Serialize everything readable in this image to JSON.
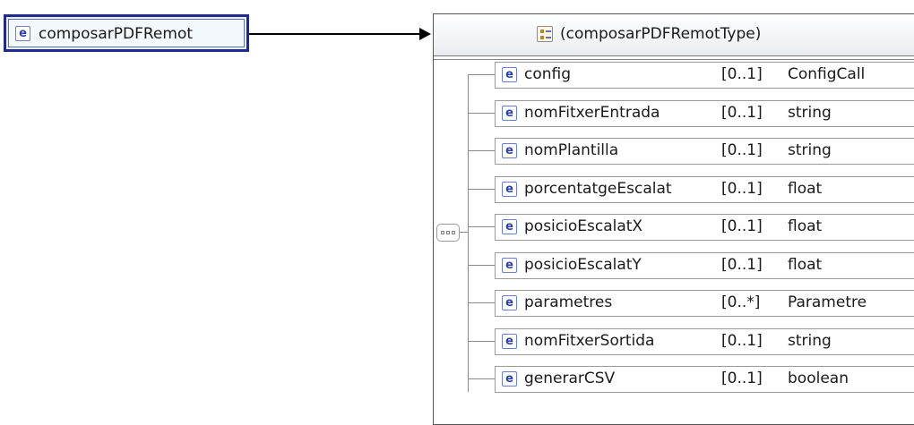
{
  "root_element": {
    "icon": "e",
    "name": "composarPDFRemot"
  },
  "complex_type": {
    "icon": "complex-type-icon",
    "name": "(composarPDFRemotType)"
  },
  "compositor": {
    "icon": "sequence-icon"
  },
  "children": [
    {
      "icon": "e",
      "name": "config",
      "occurs": "[0..1]",
      "type": "ConfigCall"
    },
    {
      "icon": "e",
      "name": "nomFitxerEntrada",
      "occurs": "[0..1]",
      "type": "string"
    },
    {
      "icon": "e",
      "name": "nomPlantilla",
      "occurs": "[0..1]",
      "type": "string"
    },
    {
      "icon": "e",
      "name": "porcentatgeEscalat",
      "occurs": "[0..1]",
      "type": "float"
    },
    {
      "icon": "e",
      "name": "posicioEscalatX",
      "occurs": "[0..1]",
      "type": "float"
    },
    {
      "icon": "e",
      "name": "posicioEscalatY",
      "occurs": "[0..1]",
      "type": "float"
    },
    {
      "icon": "e",
      "name": "parametres",
      "occurs": "[0..*]",
      "type": "Parametre"
    },
    {
      "icon": "e",
      "name": "nomFitxerSortida",
      "occurs": "[0..1]",
      "type": "string"
    },
    {
      "icon": "e",
      "name": "generarCSV",
      "occurs": "[0..1]",
      "type": "boolean"
    }
  ],
  "colors": {
    "root_border": "#1f2a8c",
    "root_fill": "#eaf2fb",
    "element_icon": "#2a3fb0"
  }
}
